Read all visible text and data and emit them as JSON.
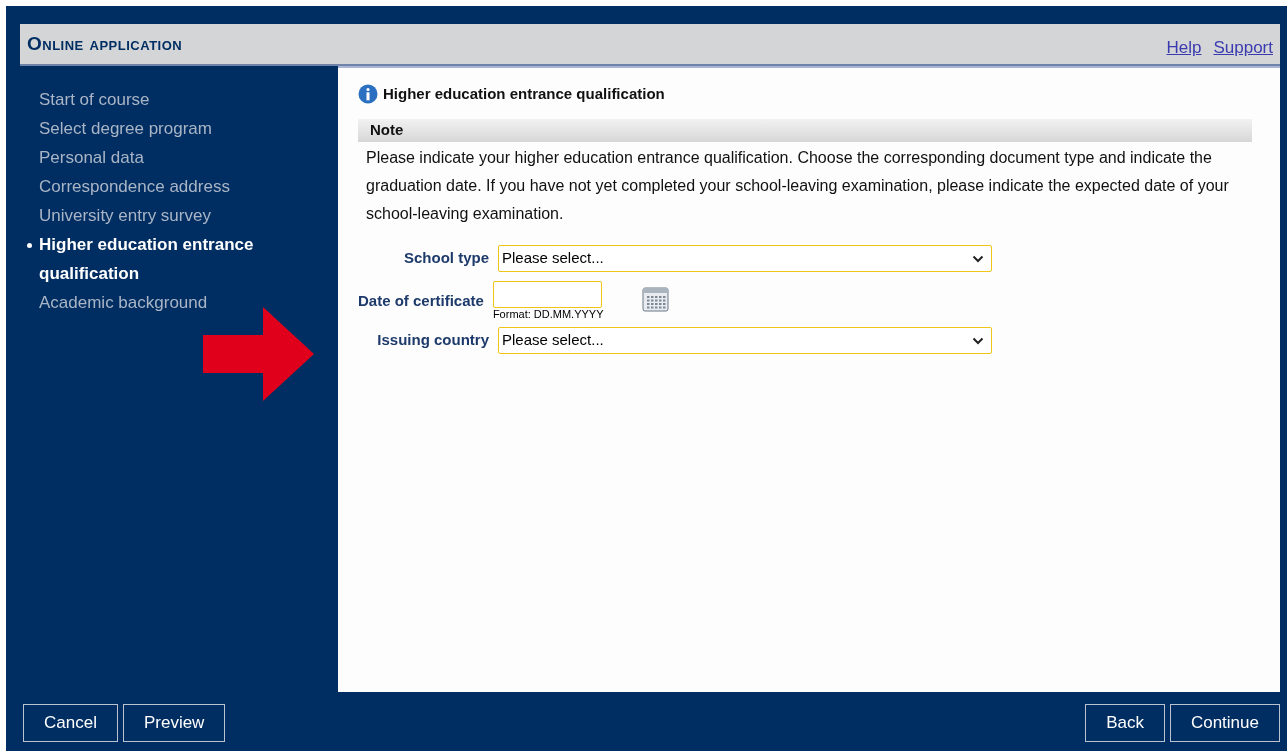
{
  "header": {
    "title": "Online application",
    "links": [
      "Help",
      "Support"
    ]
  },
  "sidebar": {
    "items": [
      {
        "label": "Start of course",
        "selected": false
      },
      {
        "label": "Select degree program",
        "selected": false
      },
      {
        "label": "Personal data",
        "selected": false
      },
      {
        "label": "Correspondence address",
        "selected": false
      },
      {
        "label": "University entry survey",
        "selected": false
      },
      {
        "label": "Higher education entrance qualification",
        "selected": true
      },
      {
        "label": "Academic background",
        "selected": false
      }
    ]
  },
  "content": {
    "heading": "Higher education entrance qualification",
    "note_title": "Note",
    "note_text": "Please indicate your higher education entrance qualification. Choose the corresponding document type and indicate the graduation date. If you have not yet completed your school-leaving examination, please indicate the expected date of your school-leaving examination.",
    "fields": [
      {
        "kind": "select",
        "label": "School type",
        "value": "Please select..."
      },
      {
        "kind": "date",
        "label": "Date of certificate",
        "hint": "Format: DD.MM.YYYY"
      },
      {
        "kind": "select",
        "label": "Issuing country",
        "value": "Please select..."
      }
    ]
  },
  "footer": {
    "left_buttons": [
      "Cancel",
      "Preview"
    ],
    "right_buttons": [
      "Back",
      "Continue"
    ]
  }
}
